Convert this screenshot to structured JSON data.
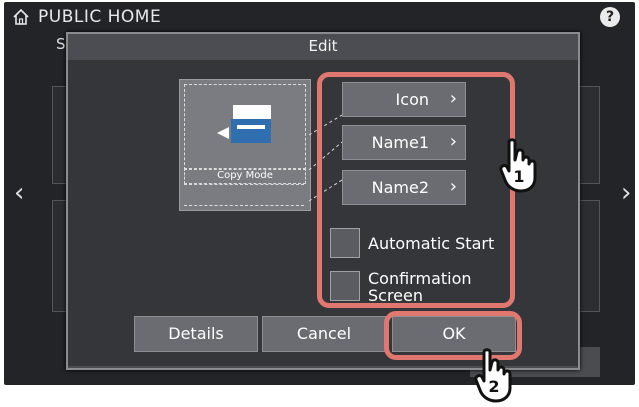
{
  "header": {
    "title": "PUBLIC HOME"
  },
  "background": {
    "partial_letter": "S"
  },
  "dialog": {
    "title": "Edit",
    "preview": {
      "caption": "Copy Mode"
    },
    "fields": [
      {
        "label": "Icon"
      },
      {
        "label": "Name1"
      },
      {
        "label": "Name2"
      }
    ],
    "checkboxes": [
      {
        "label": "Automatic Start",
        "checked": false
      },
      {
        "label": "Confirmation Screen",
        "label_line1": "Confirmation",
        "label_line2": "Screen",
        "checked": false
      }
    ],
    "buttons": {
      "details": "Details",
      "cancel": "Cancel",
      "ok": "OK"
    }
  },
  "callouts": {
    "one": "1",
    "two": "2"
  },
  "colors": {
    "callout": "#e07870",
    "dialog_bg": "#34363a",
    "button_bg": "#6a6c72"
  },
  "icons": [
    "home-icon",
    "help-icon",
    "chevron-left-icon",
    "chevron-right-icon",
    "copy-mode-icon",
    "chevron-right-icon",
    "hand-pointer-icon"
  ]
}
